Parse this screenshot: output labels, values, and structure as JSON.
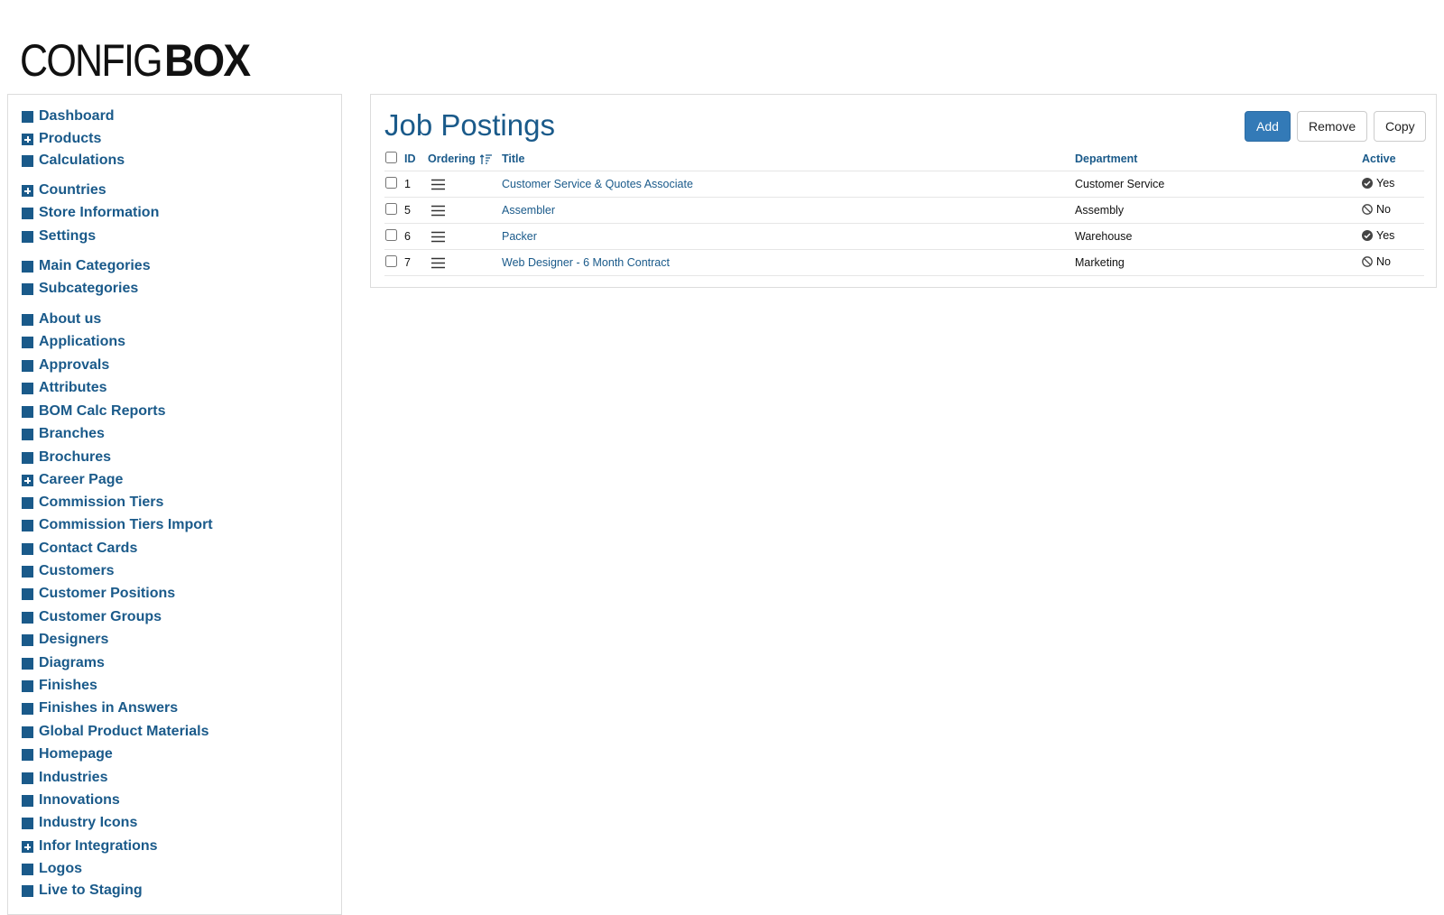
{
  "logo": {
    "light": "CONFIG",
    "bold": "BOX"
  },
  "sidebar": {
    "items": [
      {
        "label": "Dashboard",
        "icon": "square-icon"
      },
      {
        "label": "Products",
        "icon": "plus-square-icon"
      },
      {
        "label": "Calculations",
        "icon": "square-icon"
      },
      {
        "label": "Countries",
        "icon": "plus-square-icon"
      },
      {
        "label": "Store Information",
        "icon": "square-icon"
      },
      {
        "label": "Settings",
        "icon": "square-icon"
      },
      {
        "label": "Main Categories",
        "icon": "square-icon"
      },
      {
        "label": "Subcategories",
        "icon": "square-icon"
      },
      {
        "label": "About us",
        "icon": "square-icon"
      },
      {
        "label": "Applications",
        "icon": "square-icon"
      },
      {
        "label": "Approvals",
        "icon": "square-icon"
      },
      {
        "label": "Attributes",
        "icon": "square-icon"
      },
      {
        "label": "BOM Calc Reports",
        "icon": "square-icon"
      },
      {
        "label": "Branches",
        "icon": "square-icon"
      },
      {
        "label": "Brochures",
        "icon": "square-icon"
      },
      {
        "label": "Career Page",
        "icon": "plus-square-icon"
      },
      {
        "label": "Commission Tiers",
        "icon": "square-icon"
      },
      {
        "label": "Commission Tiers Import",
        "icon": "square-icon"
      },
      {
        "label": "Contact Cards",
        "icon": "square-icon"
      },
      {
        "label": "Customers",
        "icon": "square-icon"
      },
      {
        "label": "Customer Positions",
        "icon": "square-icon"
      },
      {
        "label": "Customer Groups",
        "icon": "square-icon"
      },
      {
        "label": "Designers",
        "icon": "square-icon"
      },
      {
        "label": "Diagrams",
        "icon": "square-icon"
      },
      {
        "label": "Finishes",
        "icon": "square-icon"
      },
      {
        "label": "Finishes in Answers",
        "icon": "square-icon"
      },
      {
        "label": "Global Product Materials",
        "icon": "square-icon"
      },
      {
        "label": "Homepage",
        "icon": "square-icon"
      },
      {
        "label": "Industries",
        "icon": "square-icon"
      },
      {
        "label": "Innovations",
        "icon": "square-icon"
      },
      {
        "label": "Industry Icons",
        "icon": "square-icon"
      },
      {
        "label": "Infor Integrations",
        "icon": "plus-square-icon"
      },
      {
        "label": "Logos",
        "icon": "square-icon"
      },
      {
        "label": "Live to Staging",
        "icon": "square-icon"
      }
    ]
  },
  "main": {
    "title": "Job Postings",
    "buttons": {
      "add": "Add",
      "remove": "Remove",
      "copy": "Copy"
    },
    "columns": {
      "id": "ID",
      "ordering": "Ordering",
      "title": "Title",
      "department": "Department",
      "active": "Active"
    },
    "rows": [
      {
        "id": "1",
        "title": "Customer Service & Quotes Associate",
        "department": "Customer Service",
        "active": "Yes"
      },
      {
        "id": "5",
        "title": "Assembler",
        "department": "Assembly",
        "active": "No"
      },
      {
        "id": "6",
        "title": "Packer",
        "department": "Warehouse",
        "active": "Yes"
      },
      {
        "id": "7",
        "title": "Web Designer - 6 Month Contract",
        "department": "Marketing",
        "active": "No"
      }
    ]
  },
  "colors": {
    "accent": "#1a5a8a",
    "primary_button": "#337ab7",
    "border": "#dcdcdc"
  }
}
